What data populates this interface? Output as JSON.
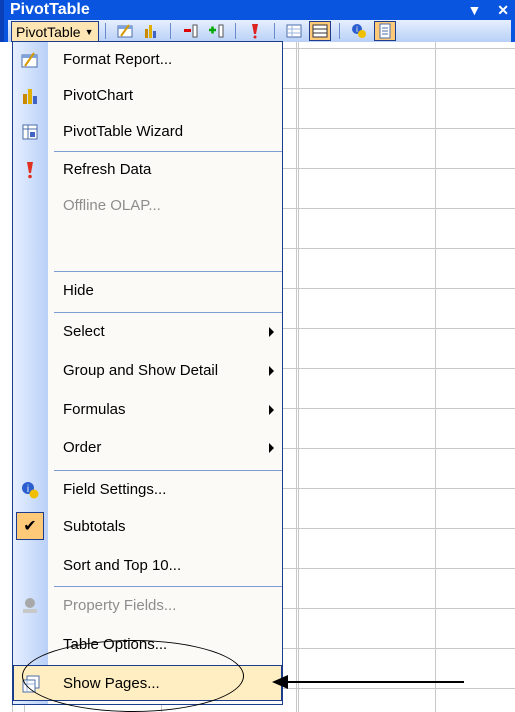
{
  "toolbar": {
    "title": "PivotTable",
    "menu_label": "PivotTable",
    "title_buttons": [
      "▼",
      "✕"
    ]
  },
  "menu": {
    "items": [
      {
        "label": "Format Report...",
        "icon": "format-report-icon"
      },
      {
        "label": "PivotChart",
        "icon": "pivotchart-icon"
      },
      {
        "label": "PivotTable Wizard",
        "icon": "wizard-icon"
      },
      {
        "label": "Refresh Data",
        "icon": "refresh-icon"
      },
      {
        "label": "Offline OLAP...",
        "disabled": true
      },
      {
        "label": "Hide"
      },
      {
        "label": "Select",
        "submenu": true
      },
      {
        "label": "Group and Show Detail",
        "submenu": true
      },
      {
        "label": "Formulas",
        "submenu": true
      },
      {
        "label": "Order",
        "submenu": true
      },
      {
        "label": "Field Settings...",
        "icon": "field-settings-icon"
      },
      {
        "label": "Subtotals",
        "icon": "checkmark-icon",
        "checked": true
      },
      {
        "label": "Sort and Top 10..."
      },
      {
        "label": "Property Fields...",
        "icon": "property-fields-icon",
        "disabled": true
      },
      {
        "label": "Table Options..."
      },
      {
        "label": "Show Pages...",
        "icon": "show-pages-icon",
        "highlighted": true
      }
    ]
  },
  "colors": {
    "title_bar": "#0a55e0",
    "menu_highlight": "#ffeec2",
    "active_button": "#ffc97a"
  }
}
